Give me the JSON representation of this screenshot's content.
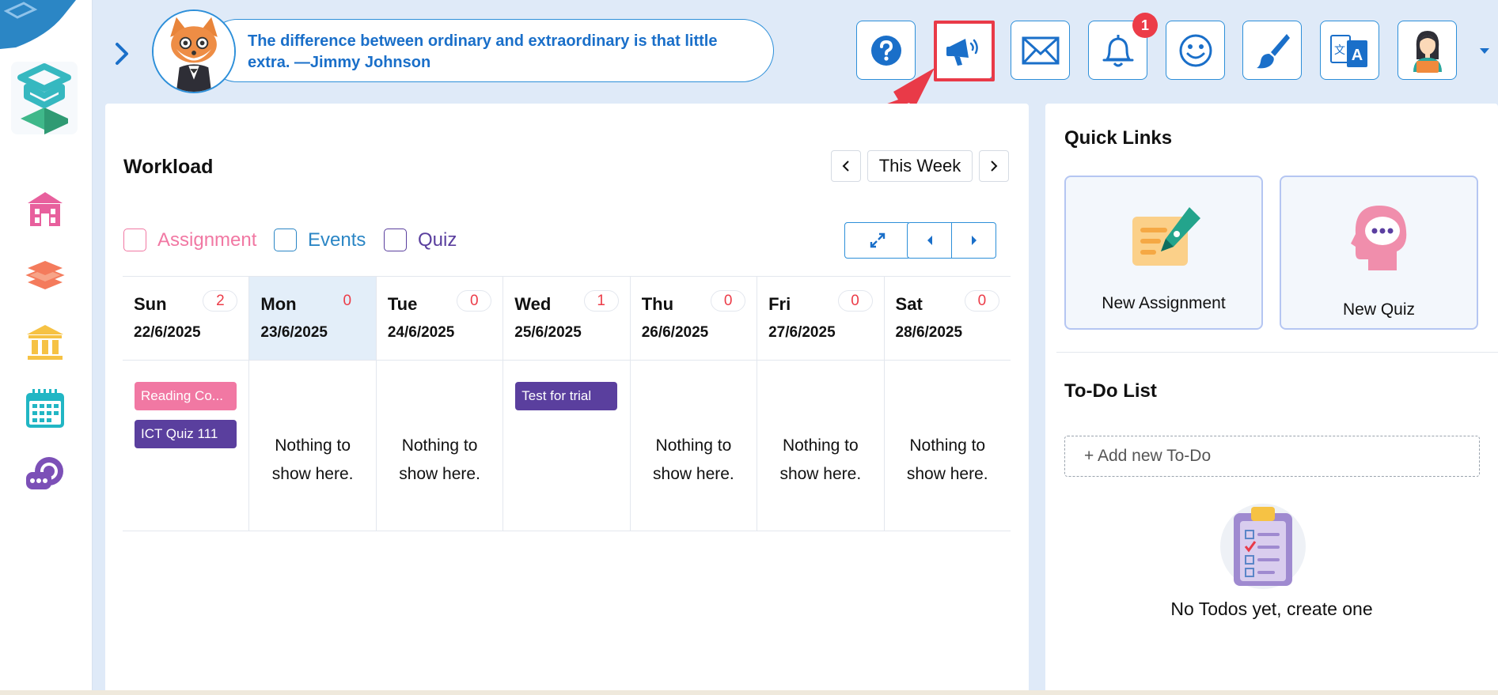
{
  "header": {
    "quote": "The difference between ordinary and extraordinary is that little extra. —Jimmy Johnson",
    "notification_count": "1",
    "icons": [
      "help-icon",
      "megaphone-icon",
      "mail-icon",
      "bell-icon",
      "smiley-icon",
      "brush-icon",
      "translate-icon",
      "profile-avatar-icon",
      "caret-down-icon"
    ]
  },
  "sidebar": {
    "items": [
      "school-icon",
      "books-icon",
      "institution-icon",
      "calendar-icon",
      "chat-icon"
    ]
  },
  "workload": {
    "title": "Workload",
    "range_label": "This Week",
    "legend": [
      {
        "label": "Assignment",
        "color": "#f178a3"
      },
      {
        "label": "Events",
        "color": "#2b86c5"
      },
      {
        "label": "Quiz",
        "color": "#5a3f9e"
      }
    ],
    "empty_text": "Nothing to show here.",
    "days": [
      {
        "name": "Sun",
        "date": "22/6/2025",
        "count": "2",
        "today": false,
        "events": [
          {
            "label": "Reading Co...",
            "type": "assignment"
          },
          {
            "label": "ICT Quiz 111",
            "type": "quiz"
          }
        ]
      },
      {
        "name": "Mon",
        "date": "23/6/2025",
        "count": "0",
        "today": true,
        "events": []
      },
      {
        "name": "Tue",
        "date": "24/6/2025",
        "count": "0",
        "today": false,
        "events": []
      },
      {
        "name": "Wed",
        "date": "25/6/2025",
        "count": "1",
        "today": false,
        "events": [
          {
            "label": "Test for trial",
            "type": "quiz"
          }
        ]
      },
      {
        "name": "Thu",
        "date": "26/6/2025",
        "count": "0",
        "today": false,
        "events": []
      },
      {
        "name": "Fri",
        "date": "27/6/2025",
        "count": "0",
        "today": false,
        "events": []
      },
      {
        "name": "Sat",
        "date": "28/6/2025",
        "count": "0",
        "today": false,
        "events": []
      }
    ]
  },
  "quick_links": {
    "title": "Quick Links",
    "items": [
      "New Assignment",
      "New Quiz"
    ]
  },
  "todo": {
    "title": "To-Do List",
    "placeholder": "+ Add new To-Do",
    "empty": "No Todos yet, create one"
  },
  "colors": {
    "accent": "#2d8fd9",
    "highlight": "#e93a48",
    "assignment": "#f178a3",
    "quiz": "#5a3f9e",
    "badge": "#ec3c48"
  }
}
